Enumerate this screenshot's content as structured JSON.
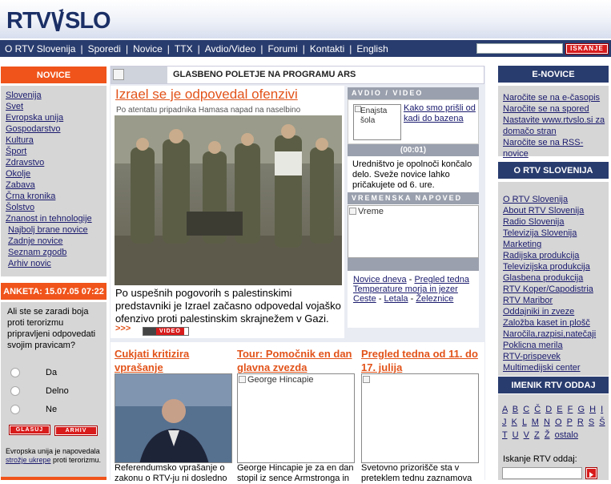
{
  "brand": {
    "logo_text_left": "RTV",
    "logo_text_right": "SLO"
  },
  "nav": {
    "items": [
      "O RTV Slovenija",
      "Sporedi",
      "Novice",
      "TTX",
      "Avdio/Video",
      "Forumi",
      "Kontakti",
      "English"
    ],
    "separator": "|"
  },
  "search": {
    "value": "",
    "button_label": "ISKANJE"
  },
  "left": {
    "novice_header": "NOVICE",
    "novice_items": [
      "Slovenija",
      "Svet",
      "Evropska unija",
      "Gospodarstvo",
      "Kultura",
      "Šport",
      "Zdravstvo",
      "Okolje",
      "Zabava",
      "Črna kronika",
      "Šolstvo",
      "Znanost in tehnologije"
    ],
    "novice_subitems": [
      "Najbolj brane novice",
      "Zadnje novice",
      "Seznam zgodb",
      "Arhiv novic"
    ],
    "poll_header": "ANKETA: 15.07.05 07:22",
    "poll_question": "Ali ste se zaradi boja proti terorizmu pripravljeni odpovedati svojim pravicam?",
    "poll_options": [
      "Da",
      "Delno",
      "Ne"
    ],
    "vote_button": "GLASUJ",
    "archive_button": "ARHIV",
    "footer_text_before": "Evropska unija je napovedala ",
    "footer_link": "strožje ukrepe",
    "footer_text_after": " proti terorizmu."
  },
  "center": {
    "top_banner_title": "GLASBENO POLETJE NA PROGRAMU ARS",
    "main_story": {
      "title": "Izrael se je odpovedal ofenzivi",
      "subtitle": "Po atentatu pripadnika Hamasa napad na naselbino",
      "body": "Po uspešnih pogovorih s palestinskimi predstavniki je Izrael začasno odpovedal vojaško ofenzivo proti palestinskim skrajnežem v Gazi.",
      "more": ">>>",
      "video_badge": "VIDEO"
    },
    "av_box": {
      "header": "AVDIO / VIDEO",
      "thumb_alt": "Enajsta šola",
      "link": "Kako smo prišli od kadi do bazena",
      "duration": "(00:01)",
      "text": "Uredništvo je opolnoči končalo delo. Sveže novice lahko pričakujete od 6. ure."
    },
    "weather": {
      "header": "VREMENSKA NAPOVED",
      "image_alt": "Vreme",
      "links": [
        "Novice dneva",
        "Pregled tedna",
        "Temperature morja in jezer",
        "Ceste",
        "Letala",
        "Železnice"
      ],
      "dash": "-"
    },
    "bottom_stories": [
      {
        "title": "Cukjati kritizira vprašanje",
        "text": "Referendumsko vprašanje o zakonu o RTV-ju ni dosledno"
      },
      {
        "title": "Tour: Pomočnik en dan glavna zvezda",
        "image_alt": "George Hincapie",
        "text": "George Hincapie je za en dan stopil iz sence Armstronga in"
      },
      {
        "title": "Pregled tedna od 11. do 17. julija",
        "text": "Svetovno prizorišče sta v preteklem tednu zaznamova"
      }
    ]
  },
  "right": {
    "enovice_header": "E-NOVICE",
    "enovice_links": [
      "Naročite se na e-časopis",
      "Naročite se na spored",
      "Nastavite www.rtvslo.si za domačo stran",
      "Naročite se na RSS-novice"
    ],
    "about_header": "O RTV SLOVENIJA",
    "about_links": [
      "O RTV Slovenija",
      "About RTV Slovenija",
      "Radio Slovenija",
      "Televizija Slovenija",
      "Marketing",
      "Radijska produkcija",
      "Televizijska produkcija",
      "Glasbena produkcija",
      "RTV Koper/Capodistria",
      "RTV Maribor",
      "Oddajniki in zveze",
      "Založba kaset in plošč",
      "Naročila,razpisi,natečaji",
      "Poklicna merila",
      "RTV-prispevek",
      "Multimedijski center"
    ],
    "imenik_header": "IMENIK RTV ODDAJ",
    "letters": [
      "A",
      "B",
      "C",
      "Č",
      "D",
      "E",
      "F",
      "G",
      "H",
      "I",
      "J",
      "K",
      "L",
      "M",
      "N",
      "O",
      "P",
      "R",
      "S",
      "Š",
      "T",
      "U",
      "V",
      "Z",
      "Ž",
      "ostalo"
    ],
    "search_label": "Iskanje RTV oddaj:",
    "search_value": ""
  },
  "colors": {
    "navy": "#293c6e",
    "orange": "#f0541b",
    "red_button": "#d81c1c",
    "link": "#1a1a6e"
  }
}
